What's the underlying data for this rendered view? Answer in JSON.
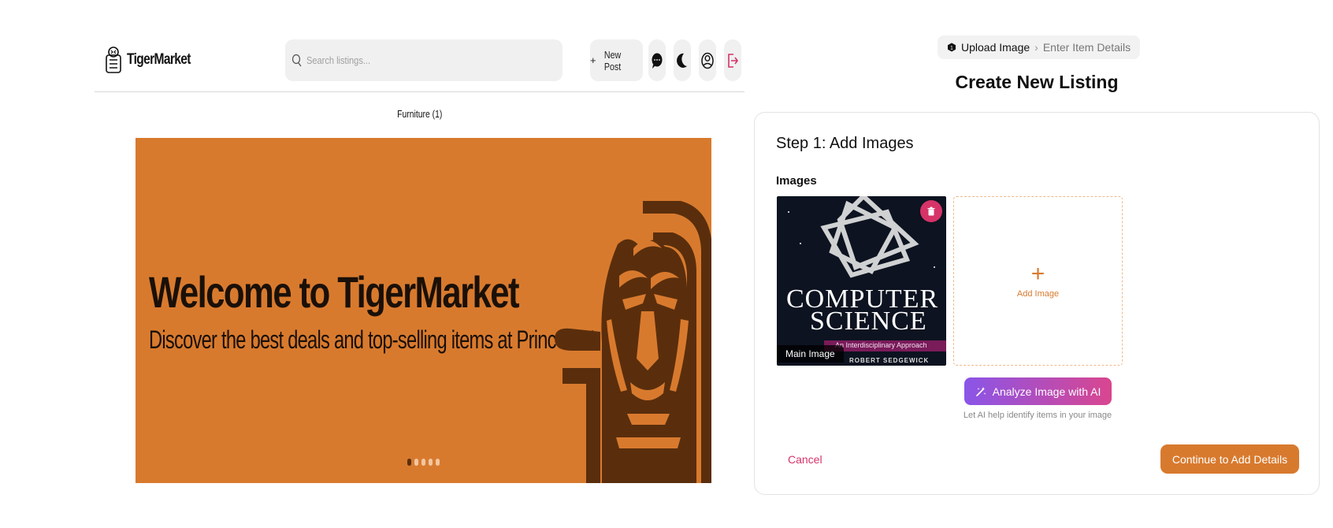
{
  "marketplace": {
    "brand": {
      "name": "TigerMarket"
    },
    "search": {
      "placeholder": "Search listings..."
    },
    "header_buttons": {
      "new_post_label": "New Post",
      "icons": [
        "chat-icon",
        "moon-icon",
        "profile-icon",
        "logout-icon"
      ]
    },
    "category_label": "Furniture (1)",
    "banner": {
      "title": "Welcome to TigerMarket",
      "subtitle": "Discover the best deals and top-selling items at Princeton!",
      "background_color": "#d87a2e",
      "slide_count": 5,
      "active_slide": 1
    }
  },
  "listing": {
    "breadcrumb": {
      "steps": [
        "Upload Image",
        "Enter Item Details"
      ],
      "active_step": 0
    },
    "page_title": "Create New Listing",
    "step_title": "Step 1: Add Images",
    "images_label": "Images",
    "uploaded_image": {
      "cover_line1": "COMPUTER",
      "cover_line2": "SCIENCE",
      "cover_subtitle": "An Interdisciplinary Approach",
      "cover_author": "ROBERT SEDGEWICK",
      "tag": "Main Image"
    },
    "add_image_label": "Add Image",
    "ai_button_label": "Analyze Image with AI",
    "ai_help_text": "Let AI help identify items in your image",
    "cancel_label": "Cancel",
    "continue_label": "Continue to Add Details",
    "colors": {
      "accent": "#d87a2e",
      "danger": "#d63368",
      "ai_gradient_start": "#8a55e8",
      "ai_gradient_end": "#d9468f"
    }
  }
}
